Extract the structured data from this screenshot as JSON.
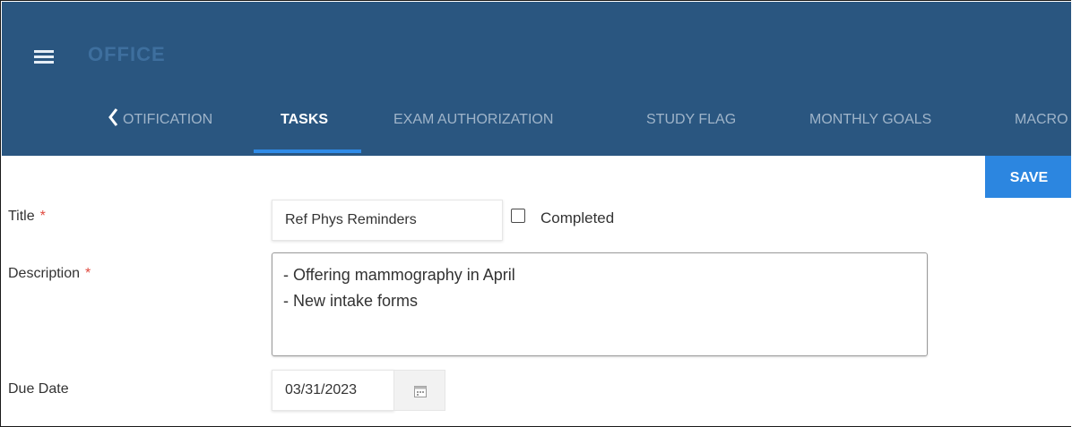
{
  "header": {
    "app_name": "OFFICE",
    "tabs": [
      {
        "label": "OTIFICATION",
        "active": false
      },
      {
        "label": "TASKS",
        "active": true
      },
      {
        "label": "EXAM AUTHORIZATION",
        "active": false
      },
      {
        "label": "STUDY FLAG",
        "active": false
      },
      {
        "label": "MONTHLY GOALS",
        "active": false
      },
      {
        "label": "MACRO",
        "active": false
      }
    ]
  },
  "form": {
    "save_label": "SAVE",
    "title_label": "Title",
    "title_value": "Ref Phys Reminders",
    "required_mark": "*",
    "completed_label": "Completed",
    "completed_checked": false,
    "description_label": "Description",
    "description_lines": [
      "- Offering mammography in April",
      "- New intake forms"
    ],
    "due_date_label": "Due Date",
    "due_date_value": "03/31/2023"
  },
  "colors": {
    "header_bg": "#2a5680",
    "accent": "#2c86e0",
    "required": "#e04a3f"
  },
  "icons": [
    "hamburger-menu-icon",
    "chevron-left-icon",
    "calendar-icon"
  ]
}
